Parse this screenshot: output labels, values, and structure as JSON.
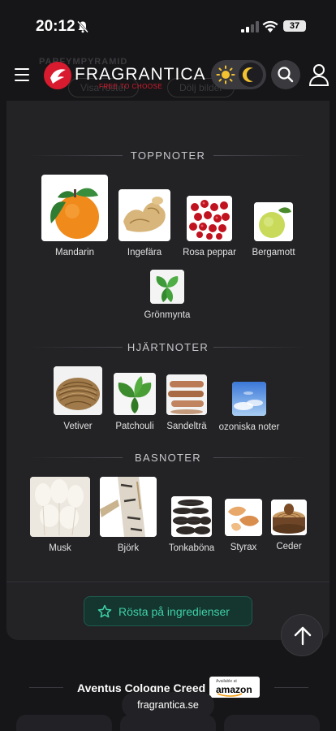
{
  "status": {
    "time": "20:12",
    "battery": "37"
  },
  "header": {
    "ghost_text": "PARFYMPYRAMID",
    "ghost_btn_1": "Visa röster",
    "ghost_btn_2": "Dölj bilder",
    "brand": "FRAGRANTICA",
    "tagline": "FREE TO CHOOSE"
  },
  "pyramid": {
    "top": {
      "title": "TOPPNOTER",
      "notes": [
        {
          "label": "Mandarin",
          "icon": "mandarin-image"
        },
        {
          "label": "Ingefära",
          "icon": "ginger-image"
        },
        {
          "label": "Rosa peppar",
          "icon": "pink-pepper-image"
        },
        {
          "label": "Bergamott",
          "icon": "bergamot-image"
        },
        {
          "label": "Grönmynta",
          "icon": "spearmint-image"
        }
      ]
    },
    "heart": {
      "title": "HJÄRTNOTER",
      "notes": [
        {
          "label": "Vetiver",
          "icon": "vetiver-image"
        },
        {
          "label": "Patchouli",
          "icon": "patchouli-image"
        },
        {
          "label": "Sandelträ",
          "icon": "sandalwood-image"
        },
        {
          "label": "ozoniska noter",
          "icon": "ozonic-image"
        }
      ]
    },
    "base": {
      "title": "BASNOTER",
      "notes": [
        {
          "label": "Musk",
          "icon": "musk-image"
        },
        {
          "label": "Björk",
          "icon": "birch-image"
        },
        {
          "label": "Tonkaböna",
          "icon": "tonka-image"
        },
        {
          "label": "Styrax",
          "icon": "styrax-image"
        },
        {
          "label": "Ceder",
          "icon": "cedar-image"
        }
      ]
    }
  },
  "vote_button": "Rösta på ingredienser",
  "footer": {
    "title": "Aventus Cologne Creed",
    "amazon_small": "Available at",
    "amazon": "amazon",
    "url": "fragrantica.se"
  },
  "colors": {
    "accent": "#3ed1a8",
    "brand_red": "#d81b2e",
    "card_bg": "#232326"
  }
}
